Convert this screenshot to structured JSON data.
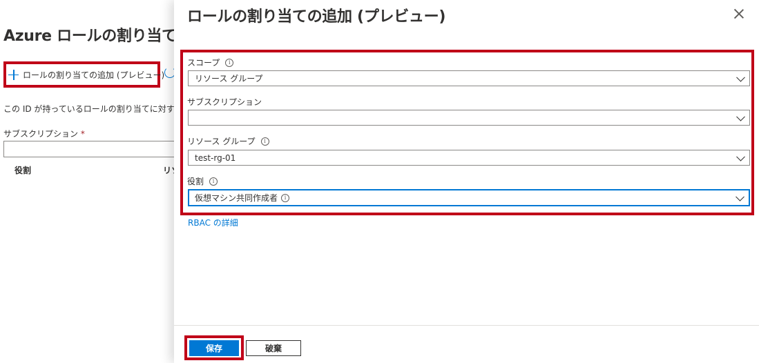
{
  "background": {
    "title": "Azure ロールの割り当て",
    "add_button_label": "ロールの割り当ての追加 (プレビュー)",
    "description": "この ID が持っているロールの割り当てに対する読",
    "subscription_label": "サブスクリプション",
    "required_mark": "*",
    "columns": [
      "役割",
      "リソ"
    ]
  },
  "panel": {
    "title": "ロールの割り当ての追加 (プレビュー)",
    "info_glyph": "i",
    "fields": {
      "scope": {
        "label": "スコープ",
        "value": "リソース グループ"
      },
      "subscription": {
        "label": "サブスクリプション",
        "value": ""
      },
      "resource_group": {
        "label": "リソース グループ",
        "value": "test-rg-01"
      },
      "role": {
        "label": "役割",
        "value": "仮想マシン共同作成者"
      }
    },
    "rbac_link": "RBAC の詳細",
    "save_label": "保存",
    "discard_label": "破棄"
  },
  "colors": {
    "accent": "#0078d4",
    "highlight": "#c00018"
  }
}
